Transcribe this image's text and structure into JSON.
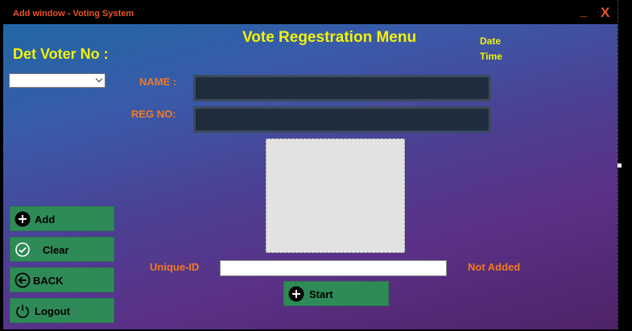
{
  "window": {
    "title": "Add window - Voting System",
    "minimize": "_",
    "close": "X"
  },
  "header": {
    "title": "Vote Regestration Menu",
    "date_label": "Date",
    "time_label": "Time"
  },
  "sidebar": {
    "voter_label": "Det Voter No :",
    "voter_select_value": "",
    "buttons": {
      "add": "Add",
      "clear": "Clear",
      "back": "BACK",
      "logout": "Logout"
    }
  },
  "form": {
    "name_label": "NAME :",
    "name_value": "",
    "reg_label": "REG NO:",
    "reg_value": "",
    "uid_label": "Unique-ID",
    "uid_value": "",
    "status": "Not Added",
    "start_label": "Start"
  },
  "colors": {
    "accent_yellow": "#f2f20a",
    "label_orange": "#f07a22",
    "button_green": "#2e8b57",
    "title_red": "#e8542a"
  }
}
